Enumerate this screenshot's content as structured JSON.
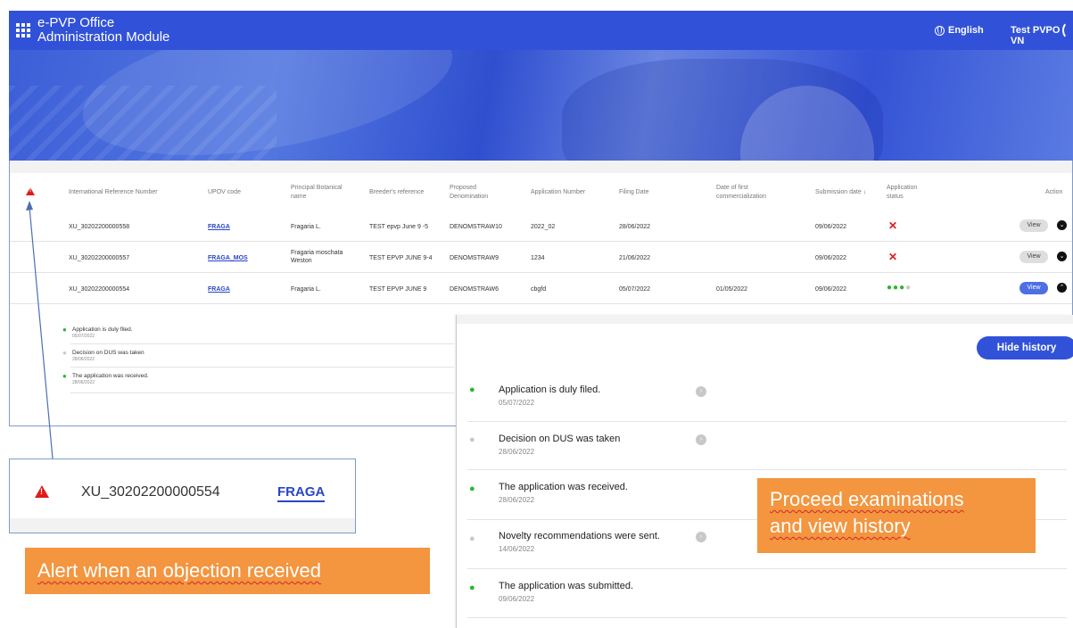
{
  "header": {
    "title_line1": "e-PVP Office",
    "title_line2": "Administration Module",
    "language": "English",
    "user": "Test PVPO VN"
  },
  "table": {
    "columns": [
      "International Reference Number",
      "UPOV code",
      "Principal Botanical name",
      "Breeder's reference",
      "Proposed Denomination",
      "Application Number",
      "Filing Date",
      "Date of first commercialization",
      "Submission date",
      "Application status",
      "Action"
    ],
    "rows": [
      {
        "ref": "XU_30202200000558",
        "upov": "FRAGA",
        "botanical": "Fragaria L.",
        "breeder": "TEST epvp June 9 -5",
        "denomination": "DENOMSTRAW10",
        "appno": "2022_02",
        "filing": "28/06/2022",
        "commercialization": "",
        "submission": "09/06/2022",
        "status": "rejected",
        "action": "View"
      },
      {
        "ref": "XU_30202200000557",
        "upov": "FRAGA_MOS",
        "botanical": "Fragaria moschata Weston",
        "breeder": "TEST EPVP JUNE 9-4",
        "denomination": "DENOMSTRAW9",
        "appno": "1234",
        "filing": "21/06/2022",
        "commercialization": "",
        "submission": "09/06/2022",
        "status": "rejected",
        "action": "View"
      },
      {
        "ref": "XU_30202200000554",
        "upov": "FRAGA",
        "botanical": "Fragaria L.",
        "breeder": "TEST EPVP JUNE 9",
        "denomination": "DENOMSTRAW6",
        "appno": "cbgfd",
        "filing": "05/07/2022",
        "commercialization": "01/05/2022",
        "submission": "09/06/2022",
        "status": "in-progress",
        "action": "View"
      }
    ]
  },
  "history_small": [
    {
      "text": "Application is duly filed.",
      "date": "05/07/2022",
      "dot": "green"
    },
    {
      "text": "Decision on DUS was taken",
      "date": "28/06/2022",
      "dot": "grey"
    },
    {
      "text": "The application was received.",
      "date": "28/06/2022",
      "dot": "green"
    }
  ],
  "callout": {
    "ref": "XU_30202200000554",
    "code": "FRAGA"
  },
  "annotations": {
    "alert": "Alert when an objection received",
    "proceed_line1": "Proceed examinations",
    "proceed_line2": "and view history"
  },
  "history": {
    "hide_label": "Hide history",
    "items": [
      {
        "text": "Application is duly filed.",
        "date": "05/07/2022",
        "dot": "green",
        "chevron": true
      },
      {
        "text": "Decision on DUS was taken",
        "date": "28/06/2022",
        "dot": "grey",
        "chevron": true
      },
      {
        "text": "The application was received.",
        "date": "28/06/2022",
        "dot": "green",
        "chevron": false
      },
      {
        "text": "Novelty recommendations were sent.",
        "date": "14/06/2022",
        "dot": "grey",
        "chevron": true
      },
      {
        "text": "The application was submitted.",
        "date": "09/06/2022",
        "dot": "green",
        "chevron": false
      }
    ]
  },
  "colors": {
    "brand": "#3152d8",
    "alert": "#e01b1b",
    "ok": "#2cb52c",
    "annotation": "#f4953f"
  }
}
